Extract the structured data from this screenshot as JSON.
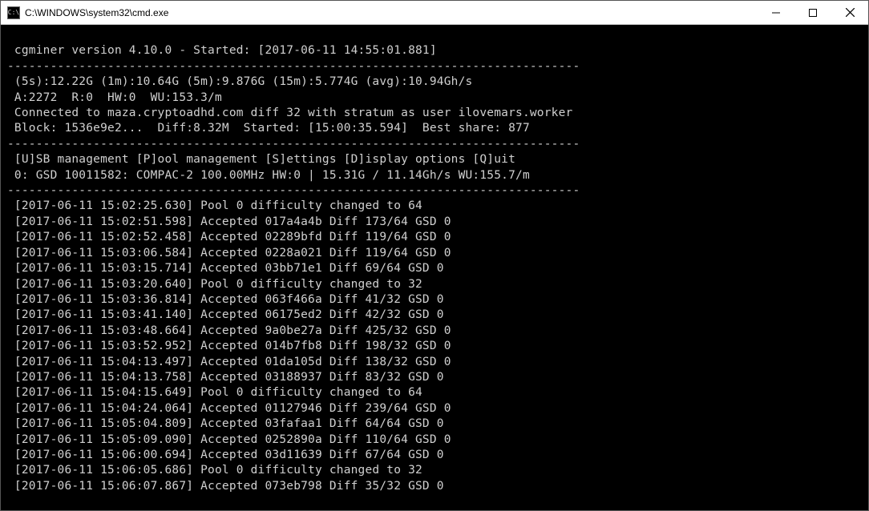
{
  "window": {
    "title": "C:\\WINDOWS\\system32\\cmd.exe"
  },
  "header": {
    "version_line": " cgminer version 4.10.0 - Started: [2017-06-11 14:55:01.881]",
    "dash1": "--------------------------------------------------------------------------------",
    "hashrates": " (5s):12.22G (1m):10.64G (5m):9.876G (15m):5.774G (avg):10.94Gh/s",
    "work": " A:2272  R:0  HW:0  WU:153.3/m",
    "connected": " Connected to maza.cryptoadhd.com diff 32 with stratum as user ilovemars.worker",
    "block": " Block: 1536e9e2...  Diff:8.32M  Started: [15:00:35.594]  Best share: 877",
    "dash2": "--------------------------------------------------------------------------------",
    "menu": " [U]SB management [P]ool management [S]ettings [D]isplay options [Q]uit",
    "device": " 0: GSD 10011582: COMPAC-2 100.00MHz HW:0 | 15.31G / 11.14Gh/s WU:155.7/m",
    "dash3": "--------------------------------------------------------------------------------"
  },
  "log": [
    " [2017-06-11 15:02:25.630] Pool 0 difficulty changed to 64",
    " [2017-06-11 15:02:51.598] Accepted 017a4a4b Diff 173/64 GSD 0",
    " [2017-06-11 15:02:52.458] Accepted 02289bfd Diff 119/64 GSD 0",
    " [2017-06-11 15:03:06.584] Accepted 0228a021 Diff 119/64 GSD 0",
    " [2017-06-11 15:03:15.714] Accepted 03bb71e1 Diff 69/64 GSD 0",
    " [2017-06-11 15:03:20.640] Pool 0 difficulty changed to 32",
    " [2017-06-11 15:03:36.814] Accepted 063f466a Diff 41/32 GSD 0",
    " [2017-06-11 15:03:41.140] Accepted 06175ed2 Diff 42/32 GSD 0",
    " [2017-06-11 15:03:48.664] Accepted 9a0be27a Diff 425/32 GSD 0",
    " [2017-06-11 15:03:52.952] Accepted 014b7fb8 Diff 198/32 GSD 0",
    " [2017-06-11 15:04:13.497] Accepted 01da105d Diff 138/32 GSD 0",
    " [2017-06-11 15:04:13.758] Accepted 03188937 Diff 83/32 GSD 0",
    " [2017-06-11 15:04:15.649] Pool 0 difficulty changed to 64",
    " [2017-06-11 15:04:24.064] Accepted 01127946 Diff 239/64 GSD 0",
    " [2017-06-11 15:05:04.809] Accepted 03fafaa1 Diff 64/64 GSD 0",
    " [2017-06-11 15:05:09.090] Accepted 0252890a Diff 110/64 GSD 0",
    " [2017-06-11 15:06:00.694] Accepted 03d11639 Diff 67/64 GSD 0",
    " [2017-06-11 15:06:05.686] Pool 0 difficulty changed to 32",
    " [2017-06-11 15:06:07.867] Accepted 073eb798 Diff 35/32 GSD 0"
  ]
}
